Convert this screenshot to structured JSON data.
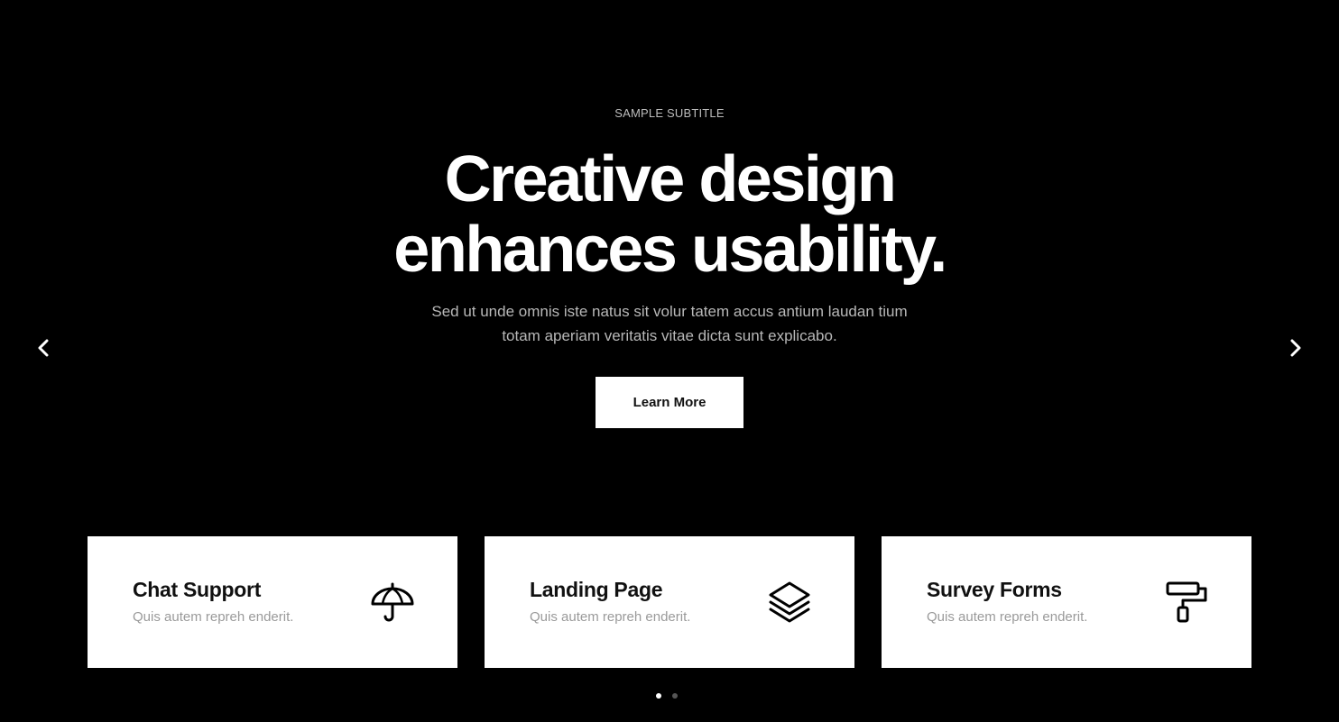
{
  "hero": {
    "subtitle": "SAMPLE SUBTITLE",
    "title_line1": "Creative design",
    "title_line2": "enhances usability.",
    "description_line1": "Sed ut unde omnis iste natus sit volur tatem accus antium laudan tium",
    "description_line2": "totam aperiam veritatis vitae dicta sunt explicabo.",
    "cta_label": "Learn More",
    "prev_icon": "chevron-left-icon",
    "next_icon": "chevron-right-icon"
  },
  "cards": [
    {
      "title": "Chat Support",
      "subtitle": "Quis autem repreh enderit.",
      "icon": "umbrella-icon"
    },
    {
      "title": "Landing Page",
      "subtitle": "Quis autem repreh enderit.",
      "icon": "layers-icon"
    },
    {
      "title": "Survey Forms",
      "subtitle": "Quis autem repreh enderit.",
      "icon": "paint-roller-icon"
    }
  ],
  "pagination": {
    "total": 2,
    "active": 1
  },
  "colors": {
    "background": "#000000",
    "card_background": "#ffffff",
    "title_text": "#ffffff",
    "muted_text": "#b8b8b8",
    "card_subtitle": "#9a9a9a"
  }
}
